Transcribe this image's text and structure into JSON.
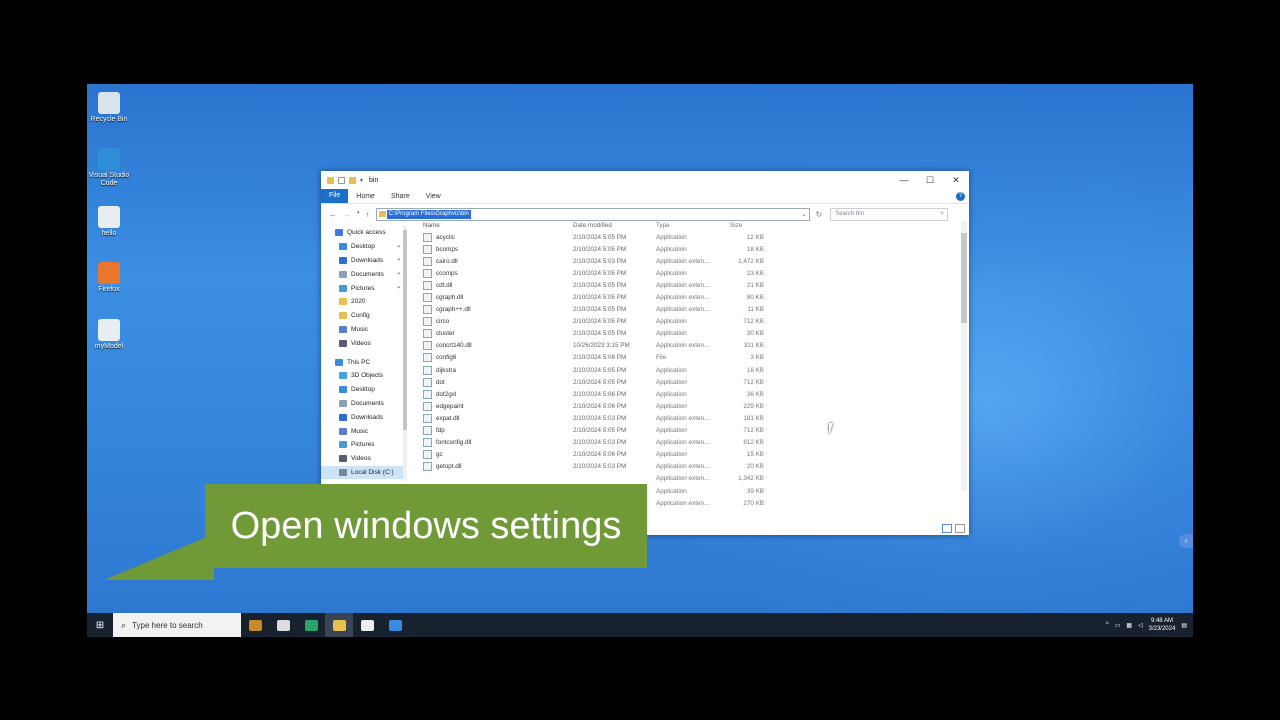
{
  "desktop": {
    "icons": [
      {
        "label": "Recycle Bin",
        "icon": "recycle-bin-icon",
        "color": "#d9e4ef"
      },
      {
        "label": "Visual Studio Code",
        "icon": "vscode-icon",
        "color": "#2f8ed8"
      },
      {
        "label": "hello",
        "icon": "python-file-icon",
        "color": "#e9eef3"
      },
      {
        "label": "Firefox",
        "icon": "firefox-icon",
        "color": "#e8762b"
      },
      {
        "label": "myModel",
        "icon": "python-file-icon",
        "color": "#e9eef3"
      }
    ]
  },
  "explorer": {
    "title": "bin",
    "window_controls": {
      "minimize": "—",
      "maximize": "☐",
      "close": "✕"
    },
    "ribbon": {
      "file": "File",
      "tabs": [
        "Home",
        "Share",
        "View"
      ],
      "help": "?"
    },
    "address": "C:\\Program Files\\Graphviz\\bin",
    "search_placeholder": "Search bin",
    "columns": {
      "name": "Name",
      "date": "Date modified",
      "type": "Type",
      "size": "Size"
    },
    "nav": [
      {
        "label": "Quick access",
        "icon": "star-icon",
        "color": "#3b7be0",
        "level": 0
      },
      {
        "label": "Desktop",
        "icon": "desktop-icon",
        "color": "#3c8ae0",
        "level": 1,
        "pinned": true
      },
      {
        "label": "Downloads",
        "icon": "download-icon",
        "color": "#2d6fd0",
        "level": 1,
        "pinned": true
      },
      {
        "label": "Documents",
        "icon": "documents-icon",
        "color": "#8aa0b8",
        "level": 1,
        "pinned": true
      },
      {
        "label": "Pictures",
        "icon": "pictures-icon",
        "color": "#4a9ad8",
        "level": 1,
        "pinned": true
      },
      {
        "label": "2020",
        "icon": "folder-icon",
        "color": "#e8c050",
        "level": 1
      },
      {
        "label": "Config",
        "icon": "folder-icon",
        "color": "#e8c050",
        "level": 1
      },
      {
        "label": "Music",
        "icon": "music-icon",
        "color": "#5a7ec8",
        "level": 1
      },
      {
        "label": "Videos",
        "icon": "videos-icon",
        "color": "#555e6e",
        "level": 1
      },
      {
        "label": "This PC",
        "icon": "pc-icon",
        "color": "#3c8ae0",
        "level": 0
      },
      {
        "label": "3D Objects",
        "icon": "3d-objects-icon",
        "color": "#47a0e0",
        "level": 1
      },
      {
        "label": "Desktop",
        "icon": "desktop-icon",
        "color": "#3c8ae0",
        "level": 1
      },
      {
        "label": "Documents",
        "icon": "documents-icon",
        "color": "#8aa0b8",
        "level": 1
      },
      {
        "label": "Downloads",
        "icon": "download-icon",
        "color": "#2d6fd0",
        "level": 1
      },
      {
        "label": "Music",
        "icon": "music-icon",
        "color": "#5a7ec8",
        "level": 1
      },
      {
        "label": "Pictures",
        "icon": "pictures-icon",
        "color": "#4a9ad8",
        "level": 1
      },
      {
        "label": "Videos",
        "icon": "videos-icon",
        "color": "#555e6e",
        "level": 1
      },
      {
        "label": "Local Disk (C:)",
        "icon": "drive-icon",
        "color": "#7a8896",
        "level": 1,
        "selected": true
      }
    ],
    "files": [
      {
        "name": "acyclic",
        "date": "2/10/2024 5:05 PM",
        "type": "Application",
        "size": "12 KB"
      },
      {
        "name": "bcomps",
        "date": "2/10/2024 5:05 PM",
        "type": "Application",
        "size": "18 KB"
      },
      {
        "name": "cairo.dll",
        "date": "2/10/2024 5:03 PM",
        "type": "Application exten...",
        "size": "1,472 KB"
      },
      {
        "name": "ccomps",
        "date": "2/10/2024 5:05 PM",
        "type": "Application",
        "size": "23 KB"
      },
      {
        "name": "cdt.dll",
        "date": "2/10/2024 5:05 PM",
        "type": "Application exten...",
        "size": "21 KB"
      },
      {
        "name": "cgraph.dll",
        "date": "2/10/2024 5:05 PM",
        "type": "Application exten...",
        "size": "80 KB"
      },
      {
        "name": "cgraph++.dll",
        "date": "2/10/2024 5:05 PM",
        "type": "Application exten...",
        "size": "11 KB"
      },
      {
        "name": "circo",
        "date": "2/10/2024 5:05 PM",
        "type": "Application",
        "size": "712 KB"
      },
      {
        "name": "cluster",
        "date": "2/10/2024 5:05 PM",
        "type": "Application",
        "size": "30 KB"
      },
      {
        "name": "concrt140.dll",
        "date": "10/26/2023 3:15 PM",
        "type": "Application exten...",
        "size": "311 KB"
      },
      {
        "name": "config6",
        "date": "2/10/2024 5:06 PM",
        "type": "File",
        "size": "3 KB"
      },
      {
        "name": "dijkstra",
        "date": "2/10/2024 5:05 PM",
        "type": "Application",
        "size": "16 KB"
      },
      {
        "name": "dot",
        "date": "2/10/2024 5:05 PM",
        "type": "Application",
        "size": "712 KB"
      },
      {
        "name": "dot2gxl",
        "date": "2/10/2024 5:06 PM",
        "type": "Application",
        "size": "36 KB"
      },
      {
        "name": "edgepaint",
        "date": "2/10/2024 5:06 PM",
        "type": "Application",
        "size": "229 KB"
      },
      {
        "name": "expat.dll",
        "date": "2/10/2024 5:03 PM",
        "type": "Application exten...",
        "size": "181 KB"
      },
      {
        "name": "fdp",
        "date": "2/10/2024 5:05 PM",
        "type": "Application",
        "size": "712 KB"
      },
      {
        "name": "fontconfig.dll",
        "date": "2/10/2024 5:03 PM",
        "type": "Application exten...",
        "size": "812 KB"
      },
      {
        "name": "gc",
        "date": "2/10/2024 5:06 PM",
        "type": "Application",
        "size": "15 KB"
      },
      {
        "name": "getopt.dll",
        "date": "2/10/2024 5:03 PM",
        "type": "Application exten...",
        "size": "20 KB"
      },
      {
        "name": "",
        "date": "",
        "type": "Application exten...",
        "size": "1,342 KB"
      },
      {
        "name": "",
        "date": "",
        "type": "Application",
        "size": "39 KB"
      },
      {
        "name": "",
        "date": "",
        "type": "Application exten...",
        "size": "270 KB"
      }
    ]
  },
  "caption": "Open windows settings",
  "taskbar": {
    "search_placeholder": "Type here to search",
    "apps": [
      {
        "icon": "briefcase-icon",
        "color": "#c98a2a"
      },
      {
        "icon": "task-view-icon",
        "color": "#dddddd"
      },
      {
        "icon": "edge-icon",
        "color": "#2aa46a"
      },
      {
        "icon": "file-explorer-icon",
        "color": "#e8c050",
        "active": true
      },
      {
        "icon": "store-icon",
        "color": "#eeeeee"
      },
      {
        "icon": "mail-icon",
        "color": "#3a8ae0"
      }
    ],
    "time": "9:48 AM",
    "date": "3/23/2024"
  }
}
